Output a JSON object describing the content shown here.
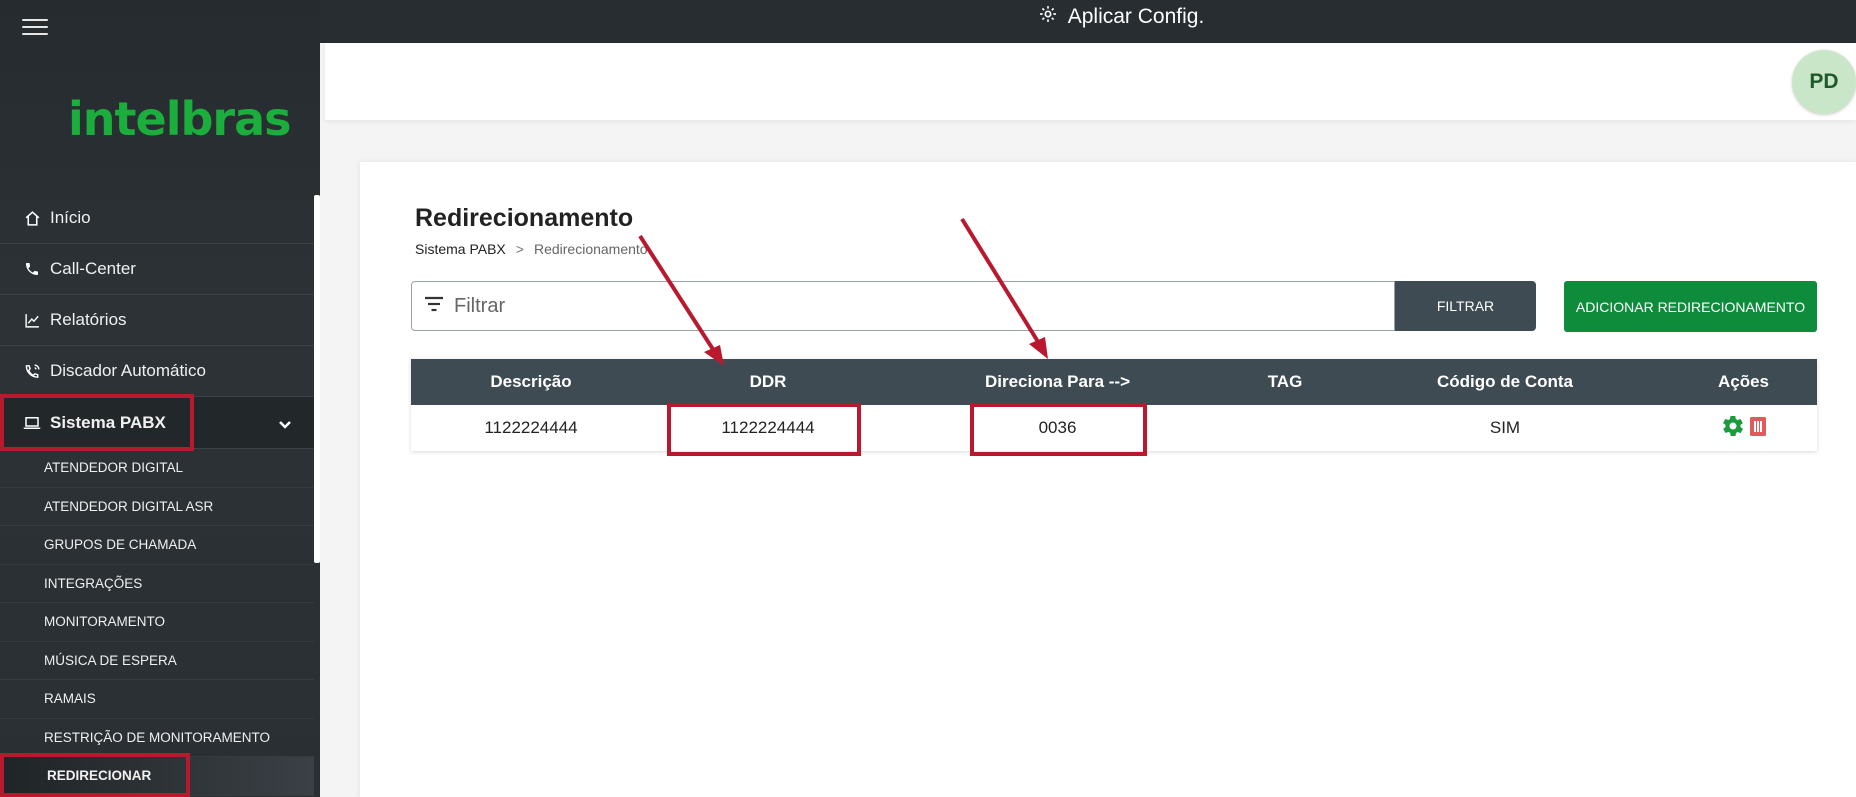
{
  "topbar": {
    "apply_label": "Aplicar Config."
  },
  "user": {
    "initials": "PD"
  },
  "brand": {
    "logo_text": "intelbras"
  },
  "sidebar": {
    "items": [
      {
        "label": "Início",
        "icon": "home-icon"
      },
      {
        "label": "Call-Center",
        "icon": "phone-icon"
      },
      {
        "label": "Relatórios",
        "icon": "chart-icon"
      },
      {
        "label": "Discador Automático",
        "icon": "phone-dialer-icon"
      },
      {
        "label": "Sistema PABX",
        "icon": "laptop-icon"
      }
    ],
    "sub_items": [
      "ATENDEDOR DIGITAL",
      "ATENDEDOR DIGITAL ASR",
      "GRUPOS DE CHAMADA",
      "INTEGRAÇÕES",
      "MONITORAMENTO",
      "MÚSICA DE ESPERA",
      "RAMAIS",
      "RESTRIÇÃO DE MONITORAMENTO",
      "REDIRECIONAR"
    ]
  },
  "page": {
    "title": "Redirecionamento",
    "breadcrumb": {
      "parent": "Sistema PABX",
      "separator": ">",
      "current": "Redirecionamento"
    }
  },
  "filter": {
    "placeholder": "Filtrar",
    "button_label": "FILTRAR"
  },
  "add_button_label": "ADICIONAR REDIRECIONAMENTO",
  "table": {
    "headers": [
      "Descrição",
      "DDR",
      "Direciona Para -->",
      "TAG",
      "Código de Conta",
      "Ações"
    ],
    "rows": [
      {
        "descricao": "1122224444",
        "ddr": "1122224444",
        "direciona": "0036",
        "tag": "",
        "codigo": "SIM"
      }
    ]
  },
  "colors": {
    "accent_green": "#0e8c3c",
    "header_gray": "#3e4b52",
    "highlight_red": "#b8192f",
    "delete_red": "#e05a5a"
  }
}
